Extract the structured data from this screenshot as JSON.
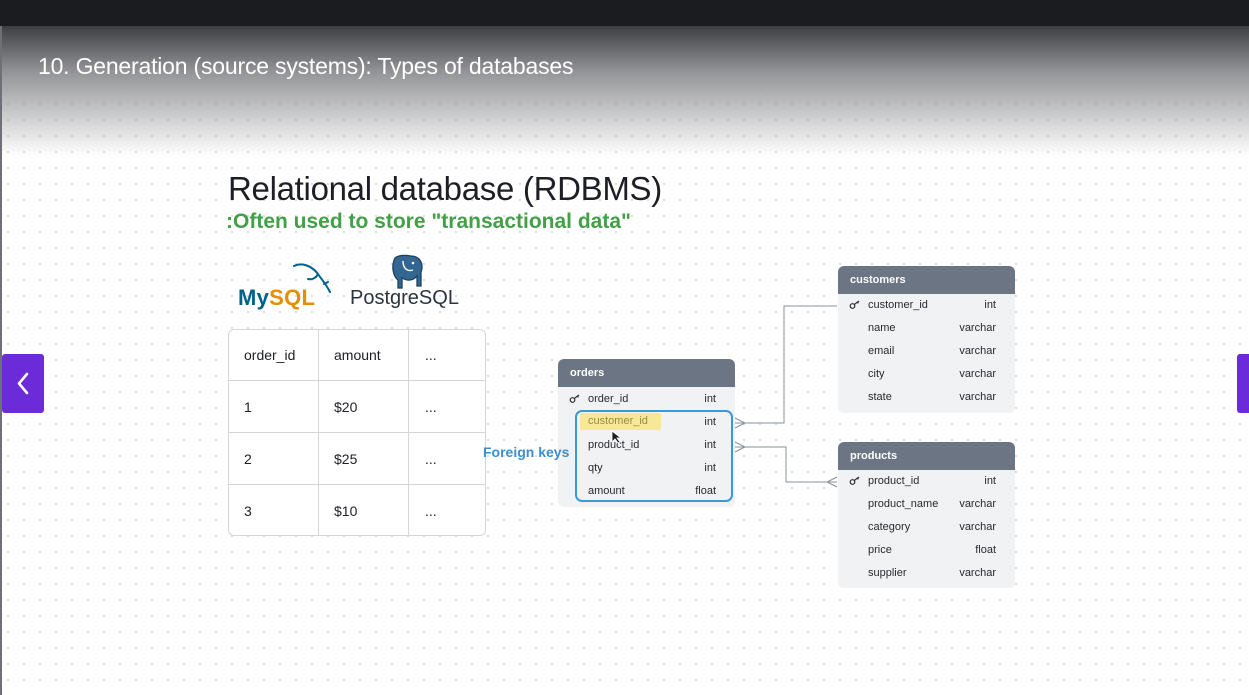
{
  "lecture": {
    "title": "10. Generation (source systems): Types of databases"
  },
  "slide": {
    "title": "Relational database (RDBMS)",
    "subtitle": ":Often used to store \"transactional data\"",
    "logos": {
      "mysql_my": "My",
      "mysql_sql": "SQL",
      "postgres": "PostgreSQL"
    },
    "table": {
      "headers": [
        "order_id",
        "amount",
        "..."
      ],
      "rows": [
        [
          "1",
          "$20",
          "..."
        ],
        [
          "2",
          "$25",
          "..."
        ],
        [
          "3",
          "$10",
          "..."
        ]
      ]
    },
    "foreign_keys_label": "Foreign keys",
    "entities": {
      "orders": {
        "name": "orders",
        "fields": [
          {
            "name": "order_id",
            "type": "int",
            "key": true
          },
          {
            "name": "customer_id",
            "type": "int",
            "key": false
          },
          {
            "name": "product_id",
            "type": "int",
            "key": false
          },
          {
            "name": "qty",
            "type": "int",
            "key": false
          },
          {
            "name": "amount",
            "type": "float",
            "key": false
          }
        ]
      },
      "customers": {
        "name": "customers",
        "fields": [
          {
            "name": "customer_id",
            "type": "int",
            "key": true
          },
          {
            "name": "name",
            "type": "varchar",
            "key": false
          },
          {
            "name": "email",
            "type": "varchar",
            "key": false
          },
          {
            "name": "city",
            "type": "varchar",
            "key": false
          },
          {
            "name": "state",
            "type": "varchar",
            "key": false
          }
        ]
      },
      "products": {
        "name": "products",
        "fields": [
          {
            "name": "product_id",
            "type": "int",
            "key": true
          },
          {
            "name": "product_name",
            "type": "varchar",
            "key": false
          },
          {
            "name": "category",
            "type": "varchar",
            "key": false
          },
          {
            "name": "price",
            "type": "float",
            "key": false
          },
          {
            "name": "supplier",
            "type": "varchar",
            "key": false
          }
        ]
      }
    }
  },
  "nav": {
    "prev_icon": "chevron-left-icon",
    "next_icon": "chevron-right-icon"
  },
  "colors": {
    "accent": "#6c2bd9",
    "subtitle": "#43a047",
    "fk_box": "#3a9ad9",
    "entity_header": "#6b7584",
    "highlight": "#f6e79b"
  }
}
